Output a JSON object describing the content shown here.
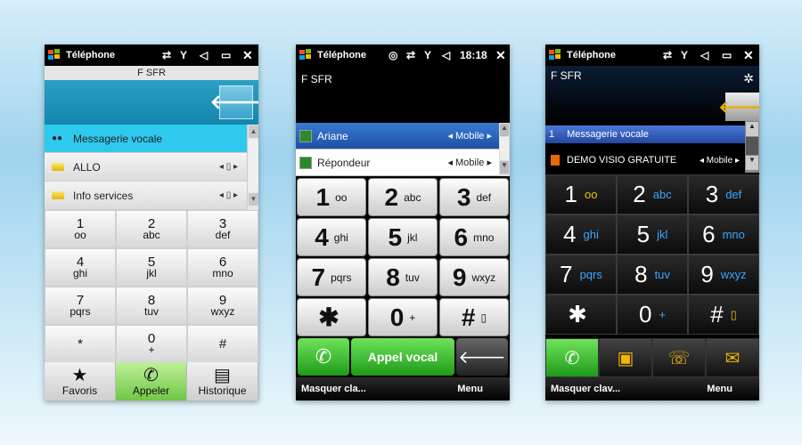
{
  "phone1": {
    "status": {
      "title": "Téléphone",
      "icons": [
        "sync-icon",
        "signal-icon",
        "volume-icon",
        "battery-icon"
      ],
      "close": "✕"
    },
    "carrier": "F SFR",
    "back": "🡐",
    "list": [
      {
        "label": "Messagerie vocale",
        "icon": "voicemail-icon",
        "selected": true
      },
      {
        "label": "ALLO",
        "icon": "contact-card-icon",
        "mobile": "◂ ▯ ▸"
      },
      {
        "label": "Info services",
        "icon": "contact-card-icon",
        "mobile": "◂ ▯ ▸"
      }
    ],
    "keys": [
      {
        "n": "1",
        "s": "oo"
      },
      {
        "n": "2",
        "s": "abc"
      },
      {
        "n": "3",
        "s": "def"
      },
      {
        "n": "4",
        "s": "ghi"
      },
      {
        "n": "5",
        "s": "jkl"
      },
      {
        "n": "6",
        "s": "mno"
      },
      {
        "n": "7",
        "s": "pqrs"
      },
      {
        "n": "8",
        "s": "tuv"
      },
      {
        "n": "9",
        "s": "wxyz"
      },
      {
        "n": "*",
        "s": ""
      },
      {
        "n": "0",
        "s": "+"
      },
      {
        "n": "#",
        "s": ""
      }
    ],
    "bottom": [
      {
        "icon": "★",
        "label": "Favoris"
      },
      {
        "icon": "✆",
        "label": "Appeler"
      },
      {
        "icon": "▤",
        "label": "Historique"
      }
    ]
  },
  "phone2": {
    "status": {
      "title": "Téléphone",
      "time": "18:18",
      "close": "✕"
    },
    "carrier": "F SFR",
    "list": [
      {
        "label": "Ariane",
        "mobile": "◂ Mobile ▸",
        "selected": true
      },
      {
        "label": "Répondeur",
        "mobile": "◂ Mobile ▸"
      }
    ],
    "keys": [
      {
        "n": "1",
        "s": "oo"
      },
      {
        "n": "2",
        "s": "abc"
      },
      {
        "n": "3",
        "s": "def"
      },
      {
        "n": "4",
        "s": "ghi"
      },
      {
        "n": "5",
        "s": "jkl"
      },
      {
        "n": "6",
        "s": "mno"
      },
      {
        "n": "7",
        "s": "pqrs"
      },
      {
        "n": "8",
        "s": "tuv"
      },
      {
        "n": "9",
        "s": "wxyz"
      },
      {
        "n": "✱",
        "s": ""
      },
      {
        "n": "0",
        "s": "+"
      },
      {
        "n": "#",
        "s": "▯"
      }
    ],
    "call_label": "Appel vocal",
    "back": "🡐",
    "softkeys": {
      "left": "Masquer cla...",
      "right": "Menu"
    }
  },
  "phone3": {
    "status": {
      "title": "Téléphone",
      "close": "✕"
    },
    "carrier": "F SFR",
    "back": "🡐",
    "list": [
      {
        "num": "1",
        "label": "Messagerie vocale",
        "selected": true
      },
      {
        "label": "DEMO VISIO GRATUITE",
        "mobile": "◂ Mobile ▸"
      }
    ],
    "keys": [
      {
        "n": "1",
        "s": "oo"
      },
      {
        "n": "2",
        "s": "abc"
      },
      {
        "n": "3",
        "s": "def"
      },
      {
        "n": "4",
        "s": "ghi"
      },
      {
        "n": "5",
        "s": "jkl"
      },
      {
        "n": "6",
        "s": "mno"
      },
      {
        "n": "7",
        "s": "pqrs"
      },
      {
        "n": "8",
        "s": "tuv"
      },
      {
        "n": "9",
        "s": "wxyz"
      },
      {
        "n": "✱",
        "s": ""
      },
      {
        "n": "0",
        "s": "+"
      },
      {
        "n": "#",
        "s": "▯"
      }
    ],
    "softkeys": {
      "left": "Masquer clav...",
      "right": "Menu"
    }
  }
}
